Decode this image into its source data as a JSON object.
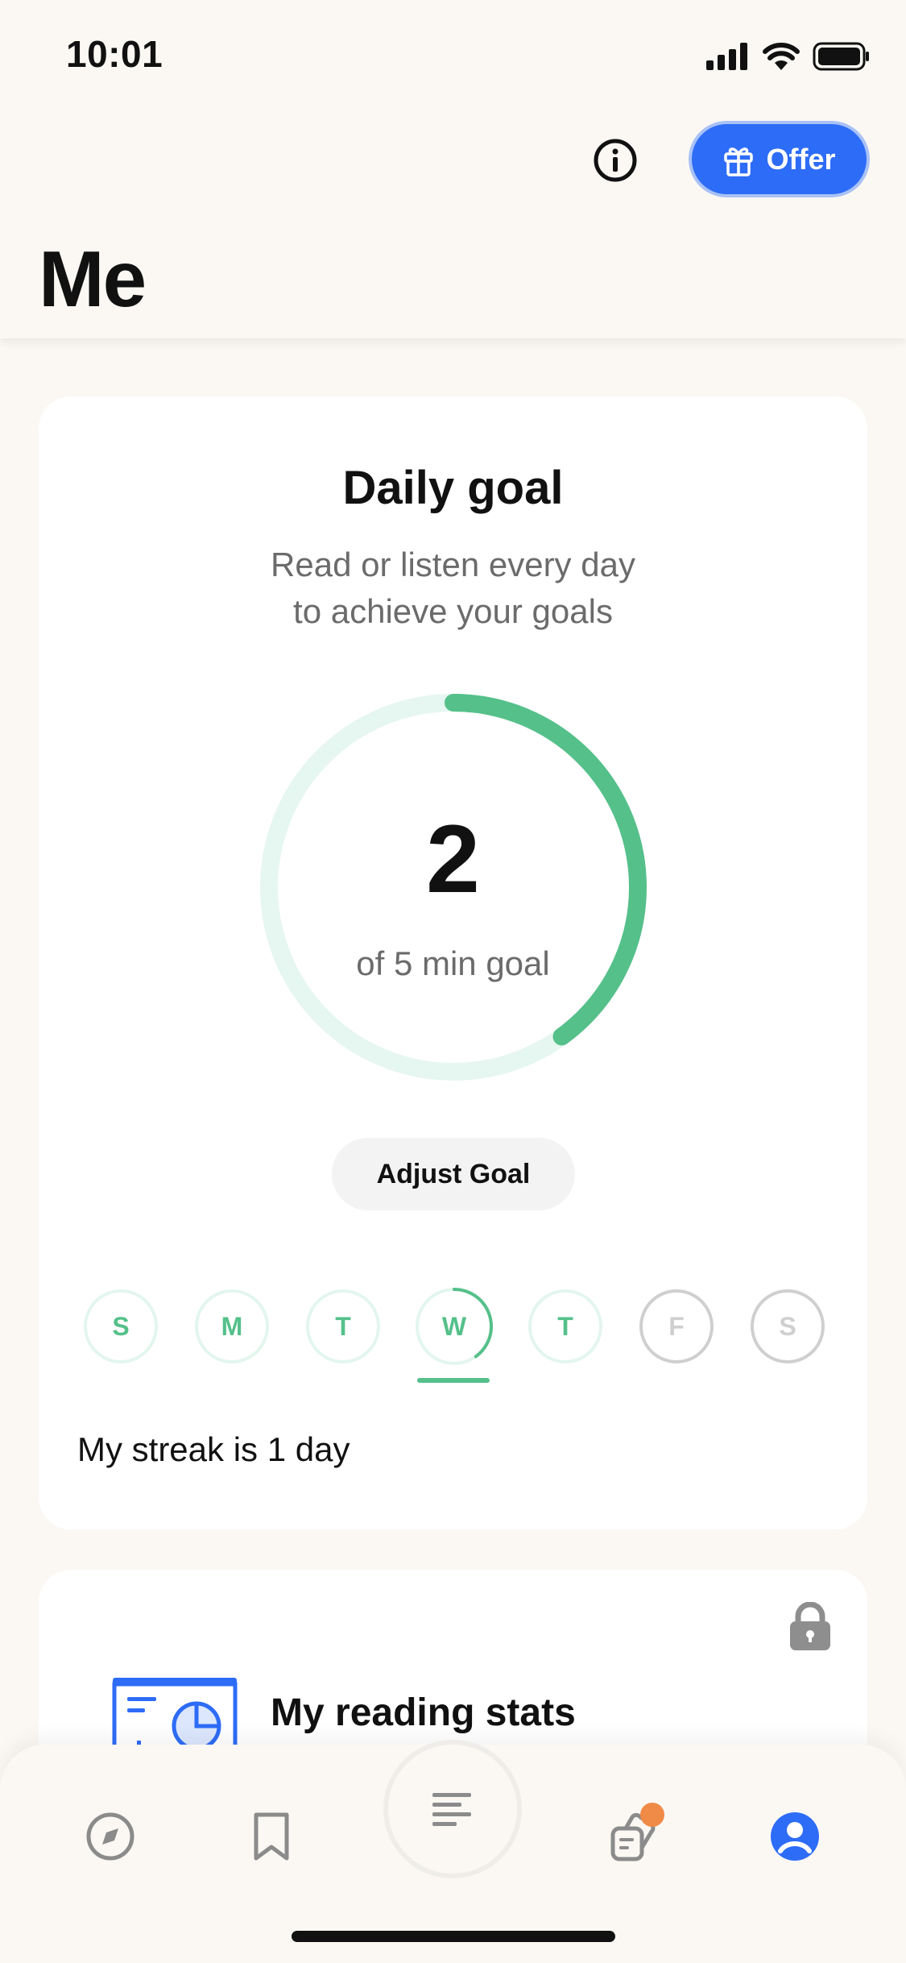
{
  "status_bar": {
    "time": "10:01"
  },
  "header": {
    "offer_label": "Offer",
    "title": "Me"
  },
  "daily_goal": {
    "title": "Daily goal",
    "subtitle_line1": "Read or listen every day",
    "subtitle_line2": "to achieve your goals",
    "progress_value": "2",
    "progress_label": "of 5 min goal",
    "progress_fraction": 0.4,
    "adjust_button": "Adjust Goal",
    "days": [
      {
        "label": "S",
        "state": "done"
      },
      {
        "label": "M",
        "state": "done"
      },
      {
        "label": "T",
        "state": "done"
      },
      {
        "label": "W",
        "state": "today"
      },
      {
        "label": "T",
        "state": "done"
      },
      {
        "label": "F",
        "state": "future"
      },
      {
        "label": "S",
        "state": "future"
      }
    ],
    "streak_text": "My streak is 1 day"
  },
  "reading_stats": {
    "title": "My reading stats",
    "locked": true
  },
  "tab_bar": {
    "tabs": [
      "compass-icon",
      "bookmark-icon",
      "library-icon",
      "highlights-icon",
      "profile-icon"
    ],
    "active": "profile-icon"
  },
  "colors": {
    "accent": "#2D6CF6",
    "goal_green": "#55C08A",
    "ring_track": "#E6F6F0",
    "badge": "#F08A47"
  }
}
